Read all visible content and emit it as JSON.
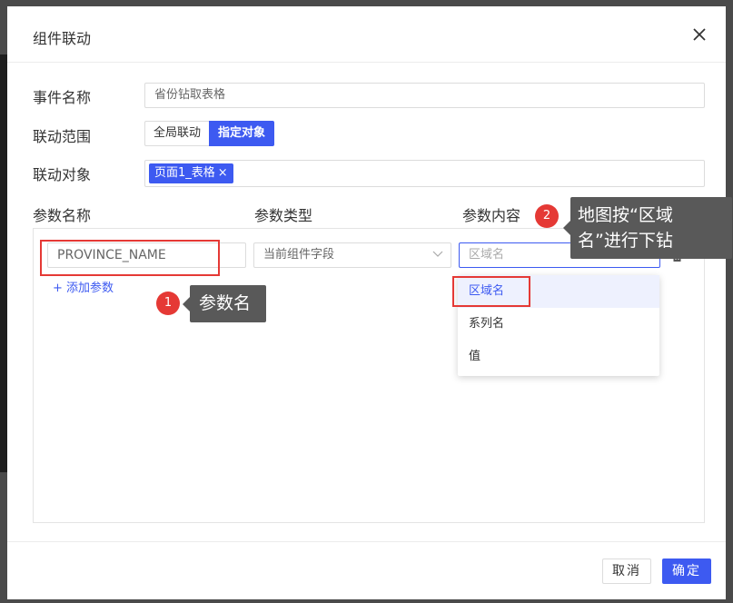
{
  "dialog": {
    "title": "组件联动"
  },
  "form": {
    "event_name_label": "事件名称",
    "event_name_value": "省份钻取表格",
    "scope_label": "联动范围",
    "scope_options": [
      "全局联动",
      "指定对象"
    ],
    "target_label": "联动对象",
    "target_tag": "页面1_表格",
    "tag_close": "×"
  },
  "params": {
    "col_name": "参数名称",
    "col_type": "参数类型",
    "col_content": "参数内容",
    "row_name_value": "PROVINCE_NAME",
    "row_type_value": "当前组件字段",
    "row_content_placeholder": "区域名",
    "add_label": "+ 添加参数"
  },
  "dropdown": {
    "items": [
      "区域名",
      "系列名",
      "值"
    ],
    "highlighted": "区域名"
  },
  "annotations": {
    "badge1": "1",
    "callout1": "参数名",
    "badge2": "2",
    "callout2_line1": "地图按“区域",
    "callout2_line2": "名”进行下钻"
  },
  "footer": {
    "cancel": "取消",
    "ok": "确定"
  },
  "colors": {
    "accent": "#3d5af1",
    "highlight_red": "#e53935",
    "callout_bg": "#595959"
  }
}
